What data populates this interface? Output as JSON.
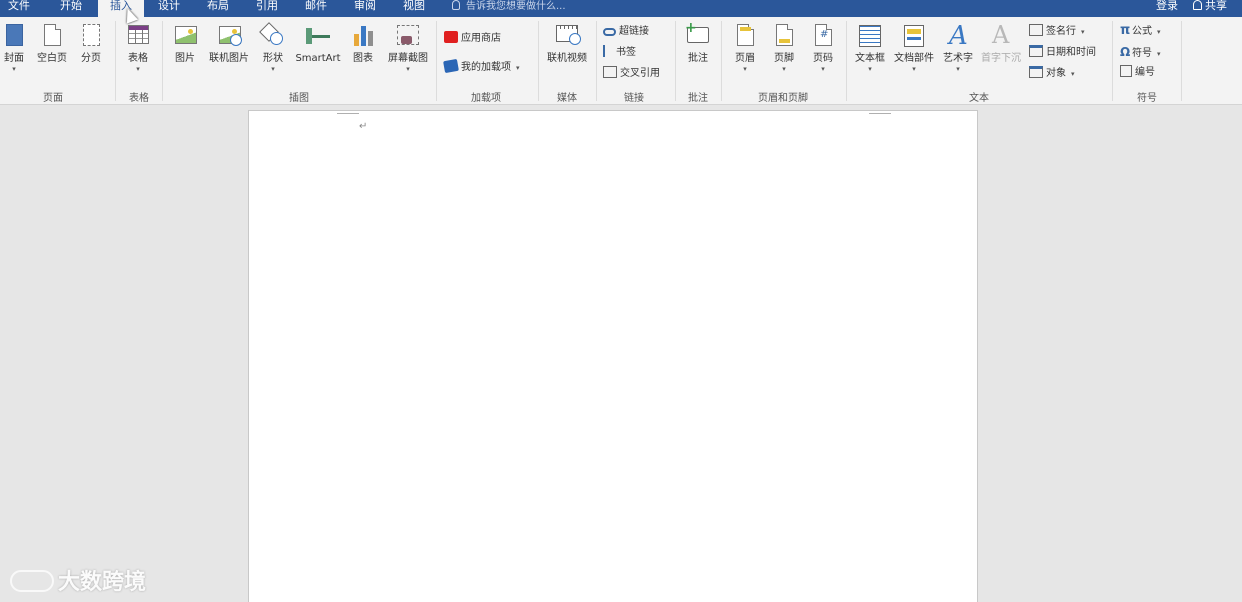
{
  "menu": {
    "tabs": [
      {
        "label": "文件"
      },
      {
        "label": "开始"
      },
      {
        "label": "插入"
      },
      {
        "label": "设计"
      },
      {
        "label": "布局"
      },
      {
        "label": "引用"
      },
      {
        "label": "邮件"
      },
      {
        "label": "审阅"
      },
      {
        "label": "视图"
      }
    ],
    "active_tab": "插入",
    "tell_me": "告诉我您想要做什么...",
    "login": "登录",
    "share": "共享"
  },
  "ribbon": {
    "groups": {
      "pages": {
        "label": "页面",
        "cover": "封面",
        "blank": "空白页",
        "break": "分页"
      },
      "tables": {
        "label": "表格",
        "table": "表格"
      },
      "illustrations": {
        "label": "插图",
        "picture": "图片",
        "online_picture": "联机图片",
        "shapes": "形状",
        "smartart": "SmartArt",
        "chart": "图表",
        "screenshot": "屏幕截图"
      },
      "addins": {
        "label": "加载项",
        "store": "应用商店",
        "my_addins": "我的加载项"
      },
      "media": {
        "label": "媒体",
        "online_video": "联机视频"
      },
      "links": {
        "label": "链接",
        "hyperlink": "超链接",
        "bookmark": "书签",
        "cross_ref": "交叉引用"
      },
      "comments": {
        "label": "批注",
        "comment": "批注"
      },
      "header_footer": {
        "label": "页眉和页脚",
        "header": "页眉",
        "footer": "页脚",
        "page_number": "页码"
      },
      "text": {
        "label": "文本",
        "textbox": "文本框",
        "quick_parts": "文档部件",
        "wordart": "艺术字",
        "drop_cap": "首字下沉",
        "signature_line": "签名行",
        "date_time": "日期和时间",
        "object": "对象"
      },
      "symbols": {
        "label": "符号",
        "equation": "公式",
        "symbol": "符号",
        "numbering": "编号"
      }
    }
  },
  "icons": {
    "equation_glyph": "π",
    "symbol_glyph": "Ω",
    "wordart_glyph": "A",
    "dropcap_glyph": "A",
    "page_number_glyph": "#",
    "para_mark": "↵",
    "dropdown": "▾",
    "collapse": "^"
  },
  "watermark": {
    "text": "大数跨境"
  },
  "colors": {
    "menubar": "#2b579a",
    "ribbon": "#f3f3f3",
    "workspace": "#e6e6e6"
  }
}
